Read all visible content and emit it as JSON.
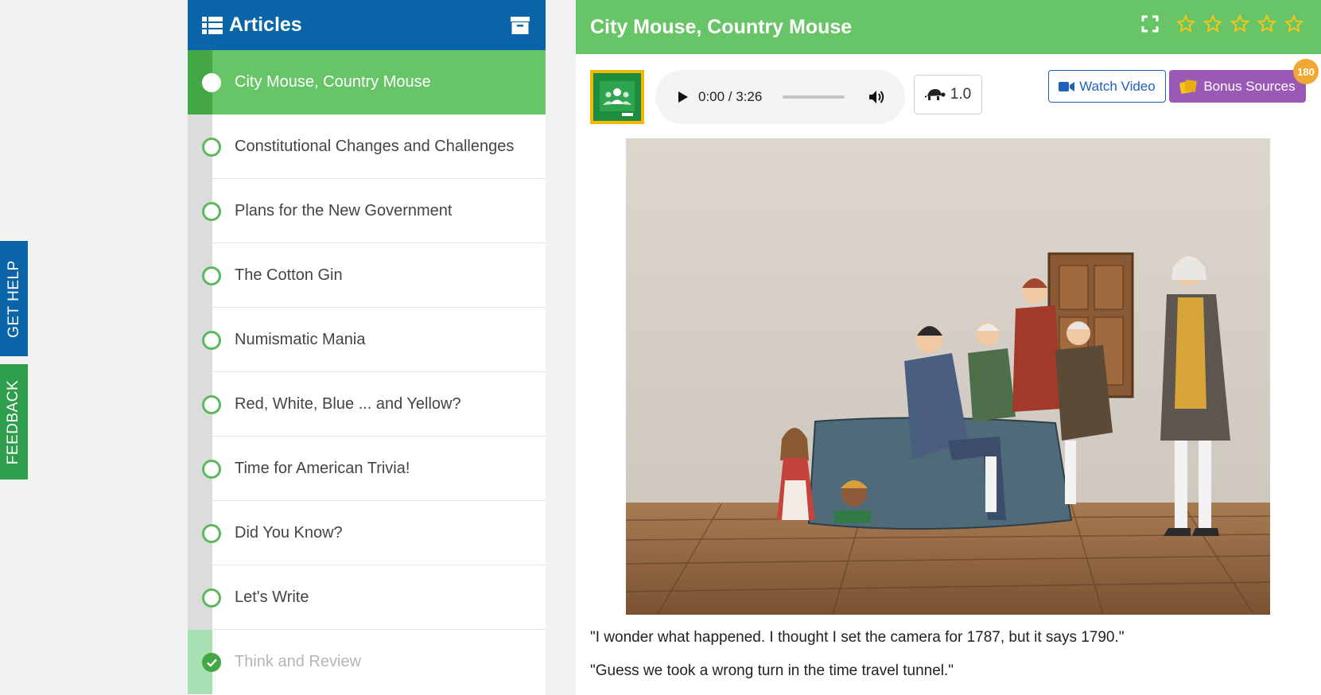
{
  "side_tabs": {
    "get_help": "GET HELP",
    "feedback": "FEEDBACK"
  },
  "articles": {
    "title": "Articles",
    "header_icons": [
      "list-icon",
      "archive-icon"
    ],
    "items": [
      {
        "label": "City Mouse, Country Mouse",
        "state": "active"
      },
      {
        "label": "Constitutional Changes and Challenges",
        "state": "unread"
      },
      {
        "label": "Plans for the New Government",
        "state": "unread"
      },
      {
        "label": "The Cotton Gin",
        "state": "unread"
      },
      {
        "label": "Numismatic Mania",
        "state": "unread"
      },
      {
        "label": "Red, White, Blue ... and Yellow?",
        "state": "unread"
      },
      {
        "label": "Time for American Trivia!",
        "state": "unread"
      },
      {
        "label": "Did You Know?",
        "state": "unread"
      },
      {
        "label": "Let's Write",
        "state": "unread"
      },
      {
        "label": "Think and Review",
        "state": "done"
      }
    ]
  },
  "main": {
    "title": "City Mouse, Country Mouse",
    "rating": {
      "stars": 5,
      "filled": 0
    },
    "header_icons": [
      "fullscreen-icon",
      "star-icon"
    ],
    "audio": {
      "time": "0:00 / 3:26",
      "icons": [
        "play-icon",
        "volume-icon"
      ]
    },
    "speed": {
      "value": "1.0",
      "icon": "turtle-icon"
    },
    "watch_video": {
      "label": "Watch Video",
      "icon": "video-camera-icon"
    },
    "bonus_sources": {
      "label": "Bonus Sources",
      "badge": "180",
      "icon": "coins-icon"
    },
    "paragraphs": [
      "\"I wonder what happened. I thought I set the camera for 1787, but it says 1790.\"",
      "\"Guess we took a wrong turn in the time travel tunnel.\""
    ]
  },
  "colors": {
    "nav_blue": "#0a64a8",
    "green": "#67c467",
    "feedback_green": "#2e9d4c",
    "purple": "#9b59b6",
    "star_gold": "#f5c518",
    "badge_orange": "#f0a830"
  }
}
